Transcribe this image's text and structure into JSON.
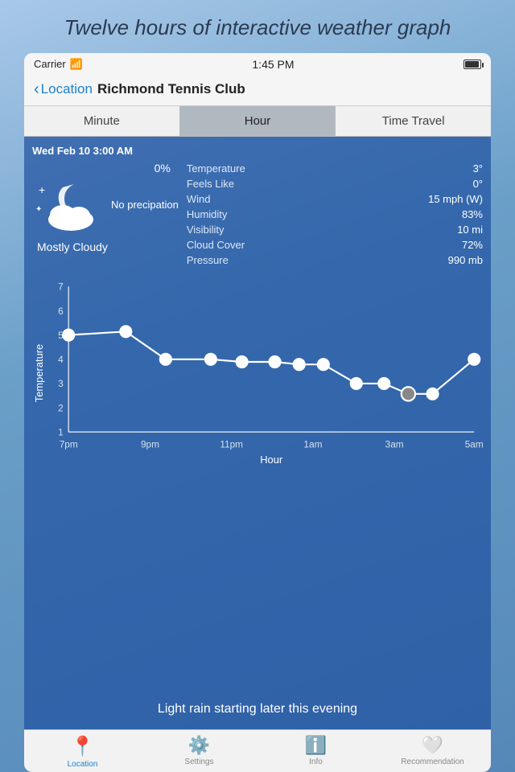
{
  "caption": {
    "text": "Twelve hours of interactive weather graph"
  },
  "status_bar": {
    "carrier": "Carrier",
    "wifi": "wifi",
    "time": "1:45 PM"
  },
  "nav": {
    "back_label": "Location",
    "location_name": "Richmond Tennis Club"
  },
  "tabs": [
    {
      "id": "minute",
      "label": "Minute",
      "active": false
    },
    {
      "id": "hour",
      "label": "Hour",
      "active": true
    },
    {
      "id": "time-travel",
      "label": "Time Travel",
      "active": false
    }
  ],
  "weather": {
    "date_time": "Wed Feb 10 3:00 AM",
    "precip_pct": "0%",
    "no_precip": "No precipation",
    "condition": "Mostly Cloudy",
    "stats": [
      {
        "label": "Temperature",
        "value": "3°"
      },
      {
        "label": "Feels Like",
        "value": "0°"
      },
      {
        "label": "Wind",
        "value": "15 mph (W)"
      },
      {
        "label": "Humidity",
        "value": "83%"
      },
      {
        "label": "Visibility",
        "value": "10 mi"
      },
      {
        "label": "Cloud Cover",
        "value": "72%"
      },
      {
        "label": "Pressure",
        "value": "990 mb"
      }
    ]
  },
  "chart": {
    "y_label": "Temperature",
    "x_label": "Hour",
    "y_ticks": [
      "7",
      "6",
      "5",
      "4",
      "3",
      "2",
      "1"
    ],
    "x_ticks": [
      "7pm",
      "9pm",
      "11pm",
      "1am",
      "3am",
      "5am"
    ],
    "points": [
      {
        "x": 0.0,
        "y": 5.0
      },
      {
        "x": 0.14,
        "y": 5.1
      },
      {
        "x": 0.24,
        "y": 4.0
      },
      {
        "x": 0.35,
        "y": 4.0
      },
      {
        "x": 0.43,
        "y": 3.9
      },
      {
        "x": 0.5,
        "y": 3.9
      },
      {
        "x": 0.57,
        "y": 3.8
      },
      {
        "x": 0.64,
        "y": 3.8
      },
      {
        "x": 0.71,
        "y": 3.2
      },
      {
        "x": 0.79,
        "y": 3.2
      },
      {
        "x": 0.86,
        "y": 3.0
      },
      {
        "x": 0.93,
        "y": 3.0
      },
      {
        "x": 1.0,
        "y": 3.9
      }
    ],
    "selected_index": 10
  },
  "forecast": {
    "text": "Light rain starting later this evening"
  },
  "bottom_nav": [
    {
      "id": "location",
      "label": "Location",
      "icon": "📍",
      "active": true
    },
    {
      "id": "settings",
      "label": "Settings",
      "icon": "⚙️",
      "active": false
    },
    {
      "id": "info",
      "label": "Info",
      "icon": "ℹ️",
      "active": false
    },
    {
      "id": "recommendation",
      "label": "Recommendation",
      "icon": "🤍",
      "active": false
    }
  ]
}
